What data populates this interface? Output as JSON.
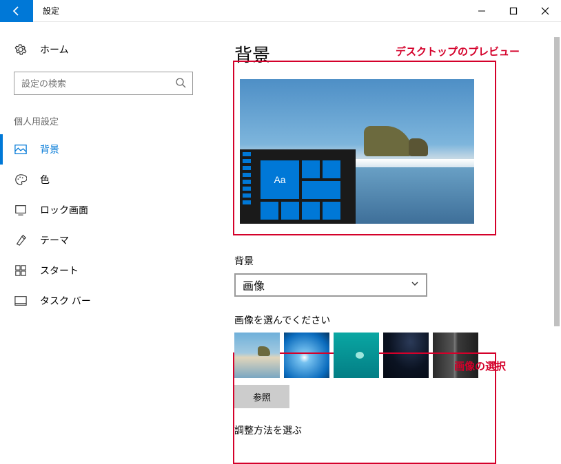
{
  "window": {
    "title": "設定"
  },
  "sidebar": {
    "home": "ホーム",
    "search_placeholder": "設定の検索",
    "section": "個人用設定",
    "items": [
      {
        "label": "背景",
        "icon": "picture"
      },
      {
        "label": "色",
        "icon": "palette"
      },
      {
        "label": "ロック画面",
        "icon": "lock-frame"
      },
      {
        "label": "テーマ",
        "icon": "theme"
      },
      {
        "label": "スタート",
        "icon": "start"
      },
      {
        "label": "タスク バー",
        "icon": "taskbar"
      }
    ]
  },
  "page": {
    "title": "背景",
    "preview_tile_text": "Aa",
    "bg_label": "背景",
    "bg_value": "画像",
    "choose_label": "画像を選んでください",
    "browse": "参照",
    "fit_label": "調整方法を選ぶ"
  },
  "annotations": {
    "preview": "デスクトップのプレビュー",
    "select": "画像の選択"
  }
}
